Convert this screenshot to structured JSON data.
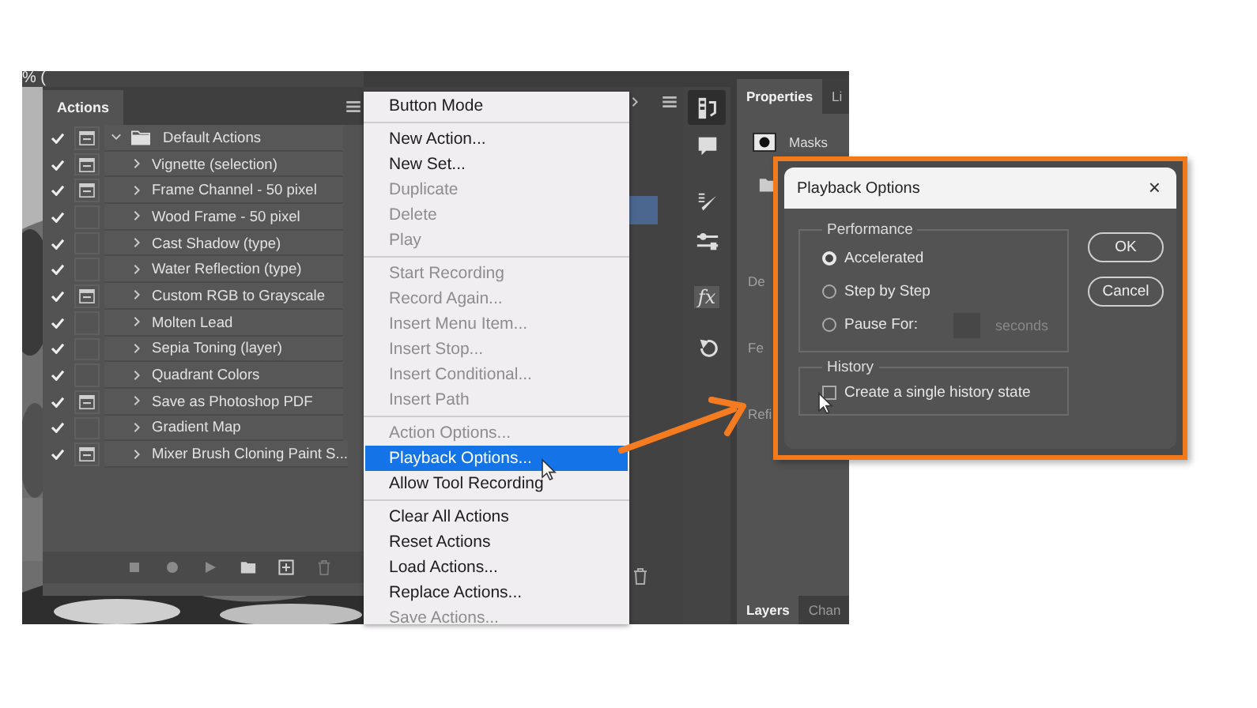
{
  "canvas": {
    "zoom_text": "% ("
  },
  "actions_panel": {
    "tab": "Actions",
    "sets": [
      {
        "name": "Default Actions",
        "checked": true,
        "dialog": true,
        "expanded": true,
        "children": [
          {
            "name": "Vignette (selection)",
            "checked": true,
            "dialog": true
          },
          {
            "name": "Frame Channel - 50 pixel",
            "checked": true,
            "dialog": true
          },
          {
            "name": "Wood Frame - 50 pixel",
            "checked": true,
            "dialog": false
          },
          {
            "name": "Cast Shadow (type)",
            "checked": true,
            "dialog": false
          },
          {
            "name": "Water Reflection (type)",
            "checked": true,
            "dialog": false
          },
          {
            "name": "Custom RGB to Grayscale",
            "checked": true,
            "dialog": true
          },
          {
            "name": "Molten Lead",
            "checked": true,
            "dialog": false
          },
          {
            "name": "Sepia Toning (layer)",
            "checked": true,
            "dialog": false
          },
          {
            "name": "Quadrant Colors",
            "checked": true,
            "dialog": false
          },
          {
            "name": "Save as Photoshop PDF",
            "checked": true,
            "dialog": true
          },
          {
            "name": "Gradient Map",
            "checked": true,
            "dialog": false
          },
          {
            "name": "Mixer Brush Cloning Paint S...",
            "checked": true,
            "dialog": true
          }
        ]
      }
    ]
  },
  "toolbar": {
    "styles_glyph": "fx"
  },
  "menu": {
    "groups": [
      [
        {
          "label": "Button Mode",
          "enabled": true,
          "selected": false
        }
      ],
      [
        {
          "label": "New Action...",
          "enabled": true,
          "selected": false
        },
        {
          "label": "New Set...",
          "enabled": true,
          "selected": false
        },
        {
          "label": "Duplicate",
          "enabled": false,
          "selected": false
        },
        {
          "label": "Delete",
          "enabled": false,
          "selected": false
        },
        {
          "label": "Play",
          "enabled": false,
          "selected": false
        }
      ],
      [
        {
          "label": "Start Recording",
          "enabled": false,
          "selected": false
        },
        {
          "label": "Record Again...",
          "enabled": false,
          "selected": false
        },
        {
          "label": "Insert Menu Item...",
          "enabled": false,
          "selected": false
        },
        {
          "label": "Insert Stop...",
          "enabled": false,
          "selected": false
        },
        {
          "label": "Insert Conditional...",
          "enabled": false,
          "selected": false
        },
        {
          "label": "Insert Path",
          "enabled": false,
          "selected": false
        }
      ],
      [
        {
          "label": "Action Options...",
          "enabled": false,
          "selected": false
        },
        {
          "label": "Playback Options...",
          "enabled": true,
          "selected": true
        },
        {
          "label": "Allow Tool Recording",
          "enabled": true,
          "selected": false
        }
      ],
      [
        {
          "label": "Clear All Actions",
          "enabled": true,
          "selected": false
        },
        {
          "label": "Reset Actions",
          "enabled": true,
          "selected": false
        },
        {
          "label": "Load Actions...",
          "enabled": true,
          "selected": false
        },
        {
          "label": "Replace Actions...",
          "enabled": true,
          "selected": false
        },
        {
          "label": "Save Actions...",
          "enabled": false,
          "selected": false
        }
      ]
    ]
  },
  "properties_panel": {
    "tabs": [
      {
        "label": "Properties",
        "selected": true
      },
      {
        "label": "Li",
        "selected": false
      }
    ],
    "masks_label": "Masks",
    "labels": [
      "De",
      "Fe",
      "Refi"
    ],
    "bottom_tabs": [
      {
        "label": "Layers",
        "selected": true
      },
      {
        "label": "Chan",
        "selected": false
      }
    ]
  },
  "dialog": {
    "title": "Playback Options",
    "close": "×",
    "performance": {
      "title": "Performance",
      "options": [
        {
          "label": "Accelerated",
          "selected": true
        },
        {
          "label": "Step by Step",
          "selected": false
        },
        {
          "label": "Pause For:",
          "selected": false
        }
      ],
      "pause_unit": "seconds"
    },
    "history": {
      "title": "History",
      "label": "Create a single history state",
      "checked": false
    },
    "buttons": [
      "OK",
      "Cancel"
    ]
  }
}
